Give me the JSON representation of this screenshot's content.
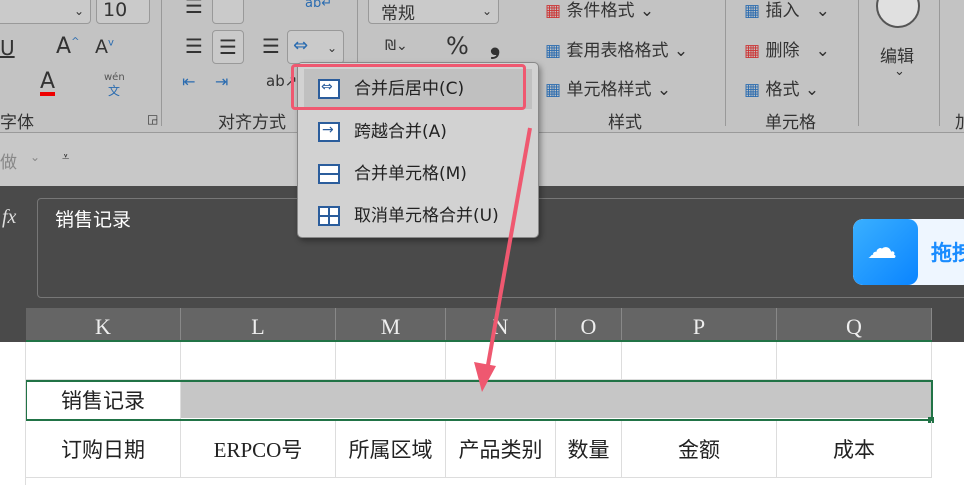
{
  "ribbon": {
    "font_size": "10",
    "number_format": "常规",
    "font_group": "字体",
    "align_group": "对齐方式",
    "styles_group": "样式",
    "cells_group": "单元格",
    "cond_format": "条件格式",
    "table_format": "套用表格格式",
    "cell_style": "单元格样式",
    "insert": "插入",
    "delete": "删除",
    "format": "格式",
    "edit": "编辑",
    "percent": "%",
    "comma": "❟",
    "wen": "wén",
    "wen_char": "文",
    "next_group_partial": "加"
  },
  "quick_access": {
    "undo_label": "做"
  },
  "merge_menu": {
    "items": [
      {
        "label": "合并后居中(C)",
        "highlighted": true
      },
      {
        "label": "跨越合并(A)"
      },
      {
        "label": "合并单元格(M)"
      },
      {
        "label": "取消单元格合并(U)"
      }
    ]
  },
  "formula_bar": {
    "fx": "fx",
    "value": "销售记录"
  },
  "baidu": {
    "label": "拖拽",
    "color": "#1a8cff"
  },
  "accent": "#ef5870",
  "grid": {
    "columns": [
      "K",
      "L",
      "M",
      "N",
      "O",
      "P",
      "Q"
    ],
    "title": "销售记录",
    "headers": [
      "订购日期",
      "ERPCO号",
      "所属区域",
      "产品类别",
      "数量",
      "金额",
      "成本"
    ]
  }
}
